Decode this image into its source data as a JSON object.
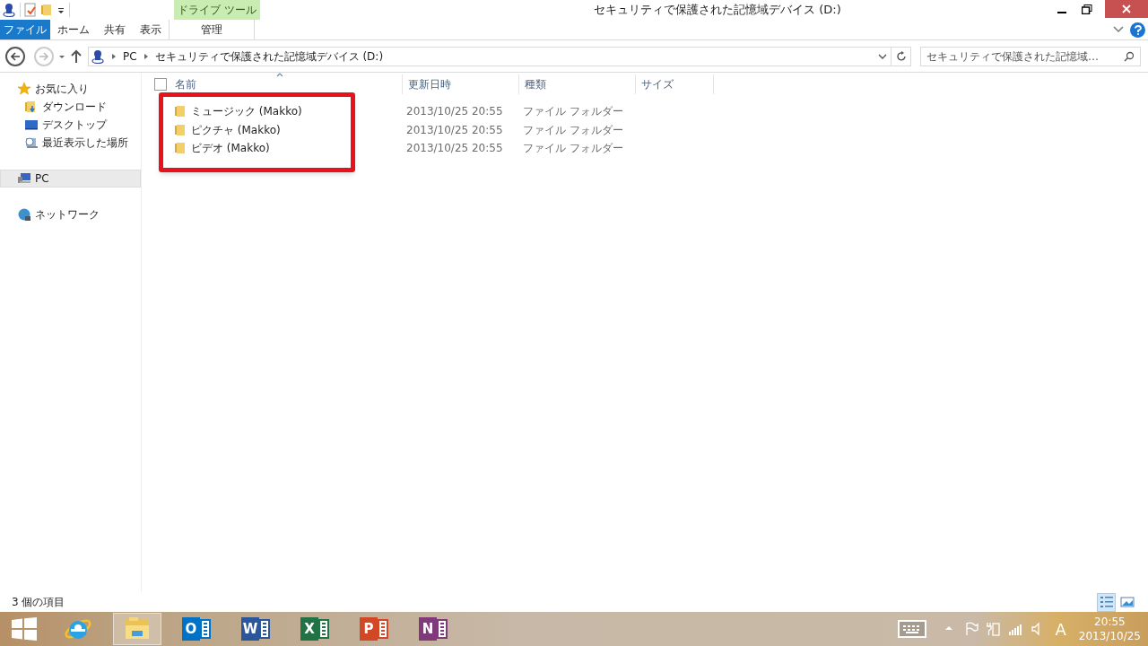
{
  "window": {
    "title": "セキュリティで保護された記憶域デバイス (D:)"
  },
  "ribbon": {
    "file_tab": "ファイル",
    "tabs": [
      {
        "label": "ホーム",
        "selected": false
      },
      {
        "label": "共有",
        "selected": false
      },
      {
        "label": "表示",
        "selected": false
      }
    ],
    "context_group": {
      "title": "ドライブ ツール",
      "tabs": [
        {
          "label": "管理",
          "selected": false
        }
      ]
    }
  },
  "address_bar": {
    "segments": [
      "PC",
      "セキュリティで保護された記憶域デバイス (D:)"
    ]
  },
  "search": {
    "placeholder": "セキュリティで保護された記憶域…"
  },
  "navigation": [
    {
      "kind": "favorites",
      "label": "お気に入り",
      "selected": false,
      "children": [
        {
          "kind": "download",
          "label": "ダウンロード",
          "selected": false
        },
        {
          "kind": "desktop",
          "label": "デスクトップ",
          "selected": false
        },
        {
          "kind": "recent",
          "label": "最近表示した場所",
          "selected": false
        }
      ]
    },
    {
      "kind": "pc",
      "label": "PC",
      "selected": true
    },
    {
      "kind": "network",
      "label": "ネットワーク",
      "selected": false
    }
  ],
  "select_all": {
    "checked": false
  },
  "columns": [
    "名前",
    "更新日時",
    "種類",
    "サイズ"
  ],
  "rows": [
    {
      "name": "ミュージック (Makko)",
      "modified": "2013/10/25 20:55",
      "type": "ファイル フォルダー"
    },
    {
      "name": "ピクチャ (Makko)",
      "modified": "2013/10/25 20:55",
      "type": "ファイル フォルダー"
    },
    {
      "name": "ビデオ (Makko)",
      "modified": "2013/10/25 20:55",
      "type": "ファイル フォルダー"
    }
  ],
  "status_bar": {
    "item_count": "3 個の項目",
    "views": [
      {
        "kind": "details",
        "selected": true
      },
      {
        "kind": "large-icons",
        "selected": false
      }
    ]
  },
  "taskbar": {
    "apps": [
      {
        "kind": "start",
        "selected": false
      },
      {
        "kind": "browser",
        "selected": false
      },
      {
        "kind": "explorer",
        "selected": true
      },
      {
        "kind": "office",
        "letter": "O",
        "color": "#0072c6",
        "selected": false
      },
      {
        "kind": "office",
        "letter": "W",
        "color": "#2b579a",
        "selected": false
      },
      {
        "kind": "office",
        "letter": "X",
        "color": "#217346",
        "selected": false
      },
      {
        "kind": "office",
        "letter": "P",
        "color": "#d24726",
        "selected": false
      },
      {
        "kind": "office",
        "letter": "N",
        "color": "#80397b",
        "selected": false
      }
    ],
    "ime": "A",
    "time": "20:55",
    "date": "2013/10/25"
  }
}
